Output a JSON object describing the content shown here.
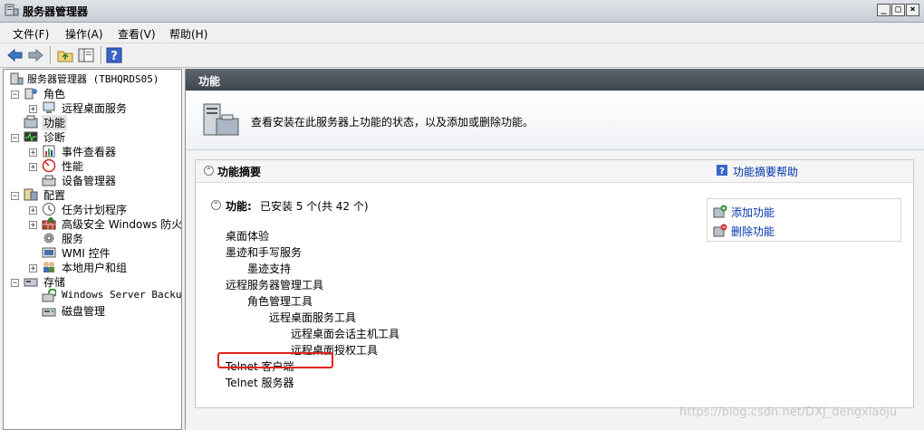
{
  "window": {
    "title": "服务器管理器"
  },
  "menu": [
    "文件(F)",
    "操作(A)",
    "查看(V)",
    "帮助(H)"
  ],
  "tree": {
    "root": "服务器管理器 (TBHQRDS05)",
    "roles": "角色",
    "rds": "远程桌面服务",
    "features": "功能",
    "diagnostics": "诊断",
    "event_viewer": "事件查看器",
    "performance": "性能",
    "device_manager": "设备管理器",
    "config": "配置",
    "task_scheduler": "任务计划程序",
    "firewall": "高级安全 Windows 防火墙",
    "services": "服务",
    "wmi": "WMI 控件",
    "local_users": "本地用户和组",
    "storage": "存储",
    "backup": "Windows Server Backup",
    "disk_mgmt": "磁盘管理"
  },
  "content": {
    "header": "功能",
    "banner_text": "查看安装在此服务器上功能的状态，以及添加或删除功能。",
    "summary_title": "功能摘要",
    "summary_help": "功能摘要帮助",
    "features_label": "功能:",
    "features_status": "已安装 5 个(共 42 个)",
    "add_feature": "添加功能",
    "remove_feature": "删除功能",
    "items": [
      "桌面体验",
      "墨迹和手写服务",
      "墨迹支持",
      "远程服务器管理工具",
      "角色管理工具",
      "远程桌面服务工具",
      "远程桌面会话主机工具",
      "远程桌面授权工具",
      "Telnet 客户端",
      "Telnet 服务器"
    ]
  },
  "watermark": "https://blog.csdn.net/DXJ_dengxiaoju"
}
